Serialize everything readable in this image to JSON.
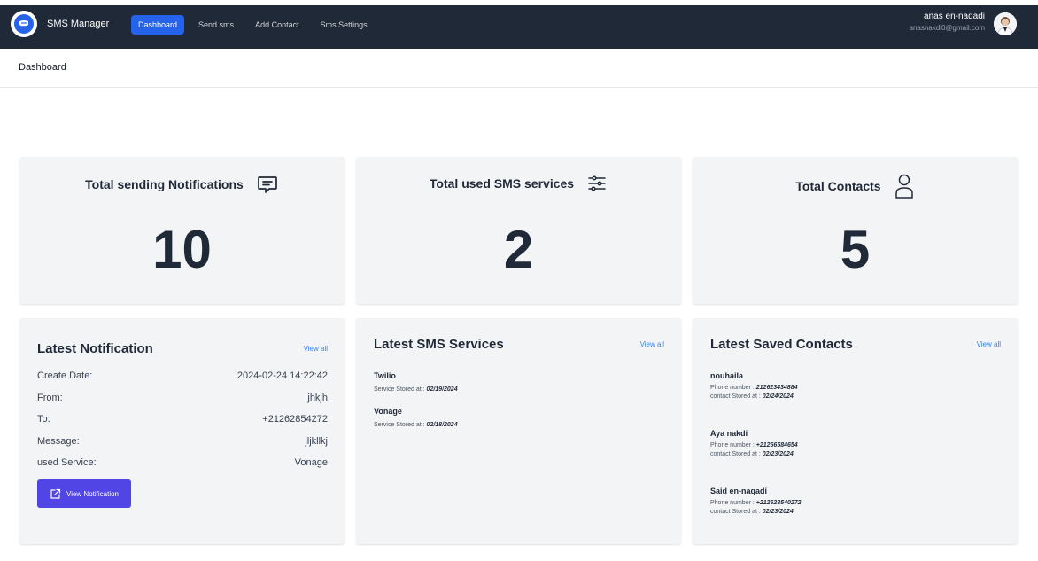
{
  "nav": {
    "brand": "SMS Manager",
    "links": [
      "Dashboard",
      "Send sms",
      "Add Contact",
      "Sms Settings"
    ],
    "user_name": "anas en-naqadi",
    "user_email": "anasnakdi0@gmail.com"
  },
  "page_title": "Dashboard",
  "stats": [
    {
      "title": "Total sending Notifications",
      "value": "10",
      "icon": "chat-bubble-icon"
    },
    {
      "title": "Total used SMS services",
      "value": "2",
      "icon": "sliders-icon"
    },
    {
      "title": "Total Contacts",
      "value": "5",
      "icon": "user-icon"
    }
  ],
  "latest_notification": {
    "title": "Latest Notification",
    "view_all": "View all",
    "rows": [
      {
        "label": "Create Date:",
        "value": "2024-02-24 14:22:42"
      },
      {
        "label": "From:",
        "value": "jhkjh"
      },
      {
        "label": "To:",
        "value": "+21262854272"
      },
      {
        "label": "Message:",
        "value": "jljkllkj"
      },
      {
        "label": "used Service:",
        "value": "Vonage"
      }
    ],
    "button": "View Notification"
  },
  "latest_services": {
    "title": "Latest SMS Services",
    "view_all": "View all",
    "stored_label": "Service Stored at :",
    "items": [
      {
        "name": "Twilio",
        "date": "02/19/2024"
      },
      {
        "name": "Vonage",
        "date": "02/18/2024"
      }
    ]
  },
  "latest_contacts": {
    "title": "Latest Saved Contacts",
    "view_all": "View all",
    "phone_label": "Phone number :",
    "stored_label": "contact Stored at :",
    "items": [
      {
        "name": "nouhaila",
        "phone": "212623434884",
        "date": "02/24/2024"
      },
      {
        "name": "Aya nakdi",
        "phone": "+21266584654",
        "date": "02/23/2024"
      },
      {
        "name": "Said en-naqadi",
        "phone": "+212628540272",
        "date": "02/23/2024"
      }
    ]
  },
  "colors": {
    "nav_bg": "#1f2937",
    "accent": "#2563eb",
    "button": "#5145e5",
    "card_bg": "#f3f4f6",
    "link": "#3b82f6"
  }
}
